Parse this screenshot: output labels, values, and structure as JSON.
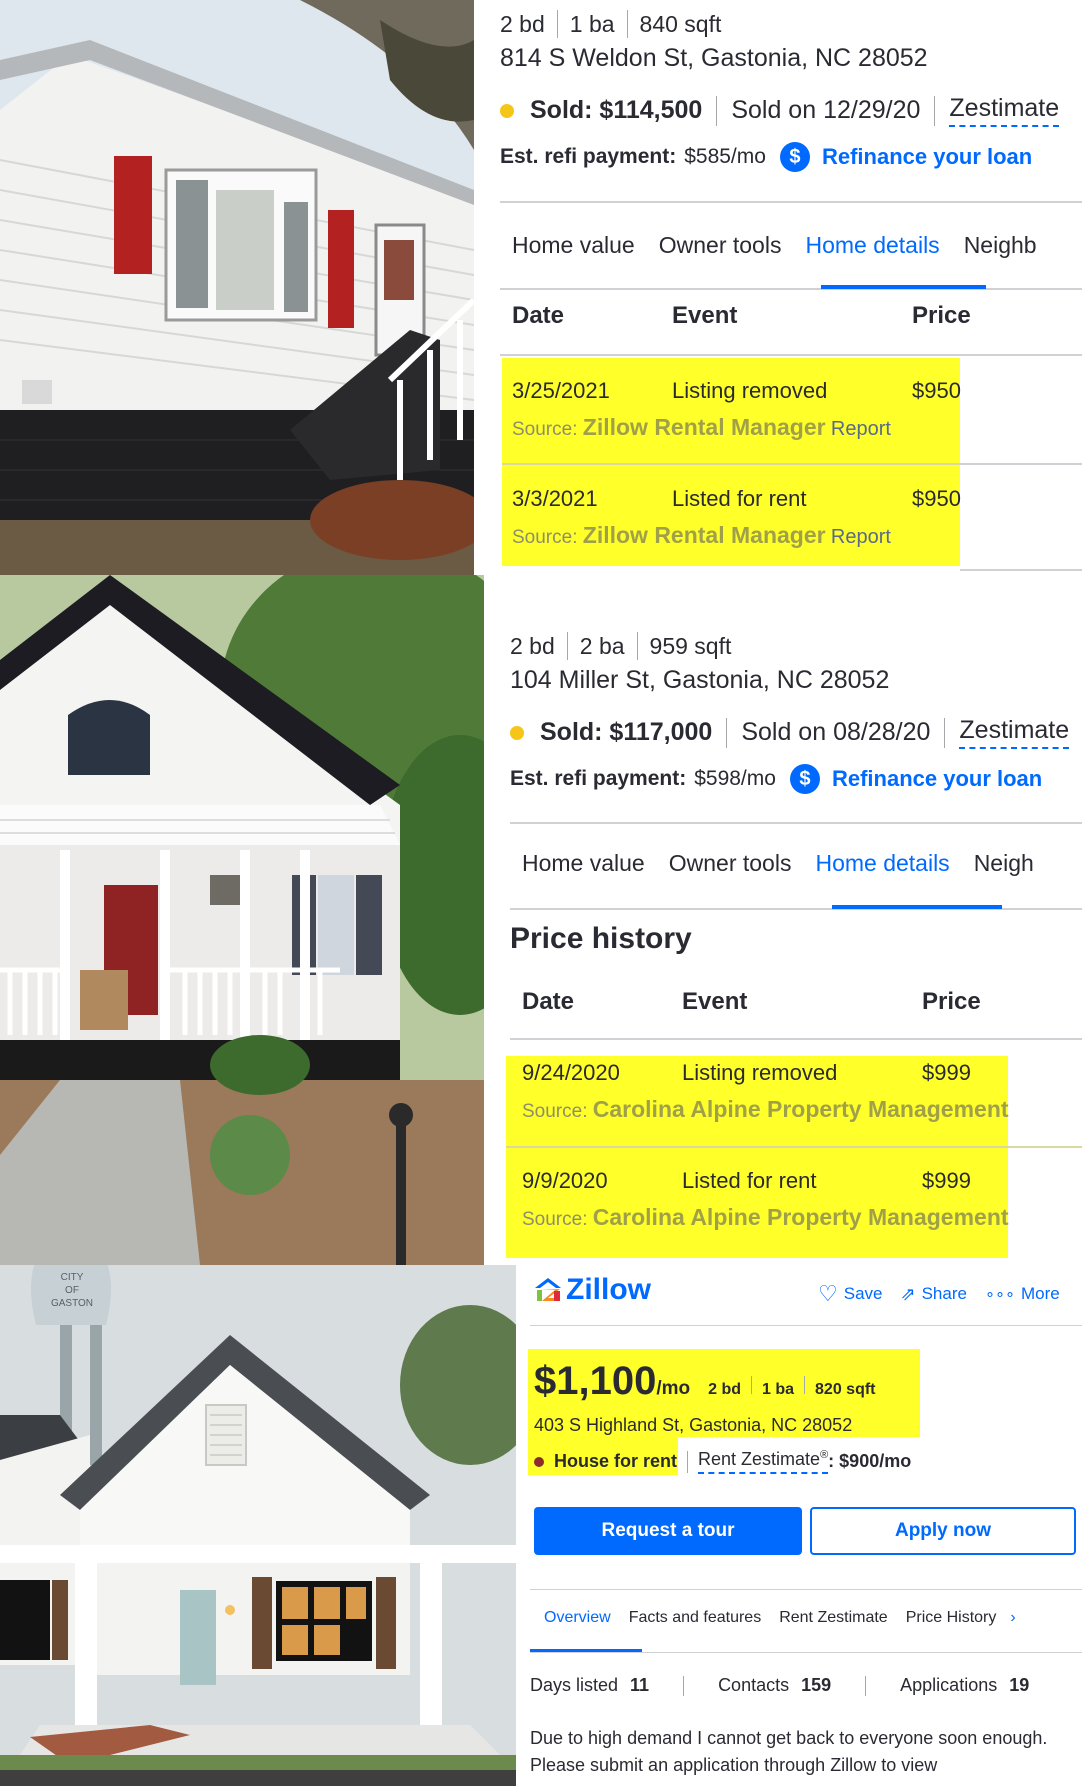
{
  "listing1": {
    "beds": "2 bd",
    "baths": "1 ba",
    "sqft": "840 sqft",
    "address": "814 S Weldon St, Gastonia, NC 28052",
    "sold": "Sold: $114,500",
    "sold_on": "Sold on 12/29/20",
    "zestimate": "Zestimate",
    "refi_label": "Est. refi payment:",
    "refi_value": "$585/mo",
    "refi_link": "Refinance your loan",
    "tabs": [
      "Home value",
      "Owner tools",
      "Home details",
      "Neighb"
    ],
    "headers": {
      "date": "Date",
      "event": "Event",
      "price": "Price"
    },
    "rows": [
      {
        "date": "3/25/2021",
        "event": "Listing removed",
        "price": "$950",
        "source_label": "Source:",
        "source": "Zillow Rental Manager",
        "report": "Report"
      },
      {
        "date": "3/3/2021",
        "event": "Listed for rent",
        "price": "$950",
        "source_label": "Source:",
        "source": "Zillow Rental Manager",
        "report": "Report"
      }
    ]
  },
  "listing2": {
    "beds": "2 bd",
    "baths": "2 ba",
    "sqft": "959 sqft",
    "address": "104 Miller St, Gastonia, NC 28052",
    "sold": "Sold: $117,000",
    "sold_on": "Sold on 08/28/20",
    "zestimate": "Zestimate",
    "refi_label": "Est. refi payment:",
    "refi_value": "$598/mo",
    "refi_link": "Refinance your loan",
    "tabs": [
      "Home value",
      "Owner tools",
      "Home details",
      "Neigh"
    ],
    "section_title": "Price history",
    "headers": {
      "date": "Date",
      "event": "Event",
      "price": "Price"
    },
    "rows": [
      {
        "date": "9/24/2020",
        "event": "Listing removed",
        "price": "$999",
        "source_label": "Source:",
        "source": "Carolina Alpine Property Management"
      },
      {
        "date": "9/9/2020",
        "event": "Listed for rent",
        "price": "$999",
        "source_label": "Source:",
        "source": "Carolina Alpine Property Management"
      }
    ]
  },
  "listing3": {
    "logo": "Zillow",
    "save": "Save",
    "share": "Share",
    "more": "More",
    "price": "$1,100",
    "per": "/mo",
    "beds": "2 bd",
    "baths": "1 ba",
    "sqft": "820 sqft",
    "address": "403 S Highland St, Gastonia, NC 28052",
    "status": "House for rent",
    "rent_zest_label": "Rent Zestimate",
    "reg": "®",
    "rent_zest_value": ": $900/mo",
    "request_tour": "Request a tour",
    "apply_now": "Apply now",
    "tabs": [
      "Overview",
      "Facts and features",
      "Rent Zestimate",
      "Price History"
    ],
    "stats": {
      "days_label": "Days listed",
      "days": "11",
      "contacts_label": "Contacts",
      "contacts": "159",
      "apps_label": "Applications",
      "apps": "19"
    },
    "description": "Due to high demand I cannot get back to everyone soon enough. Please submit an application through Zillow to view"
  },
  "photo_water_tower_text": "CITY OF GASTONIA",
  "colors": {
    "accent": "#006aff",
    "highlight": "#ffff2a",
    "sold_dot": "#f5c518",
    "rent_dot": "#8b2b2b"
  }
}
